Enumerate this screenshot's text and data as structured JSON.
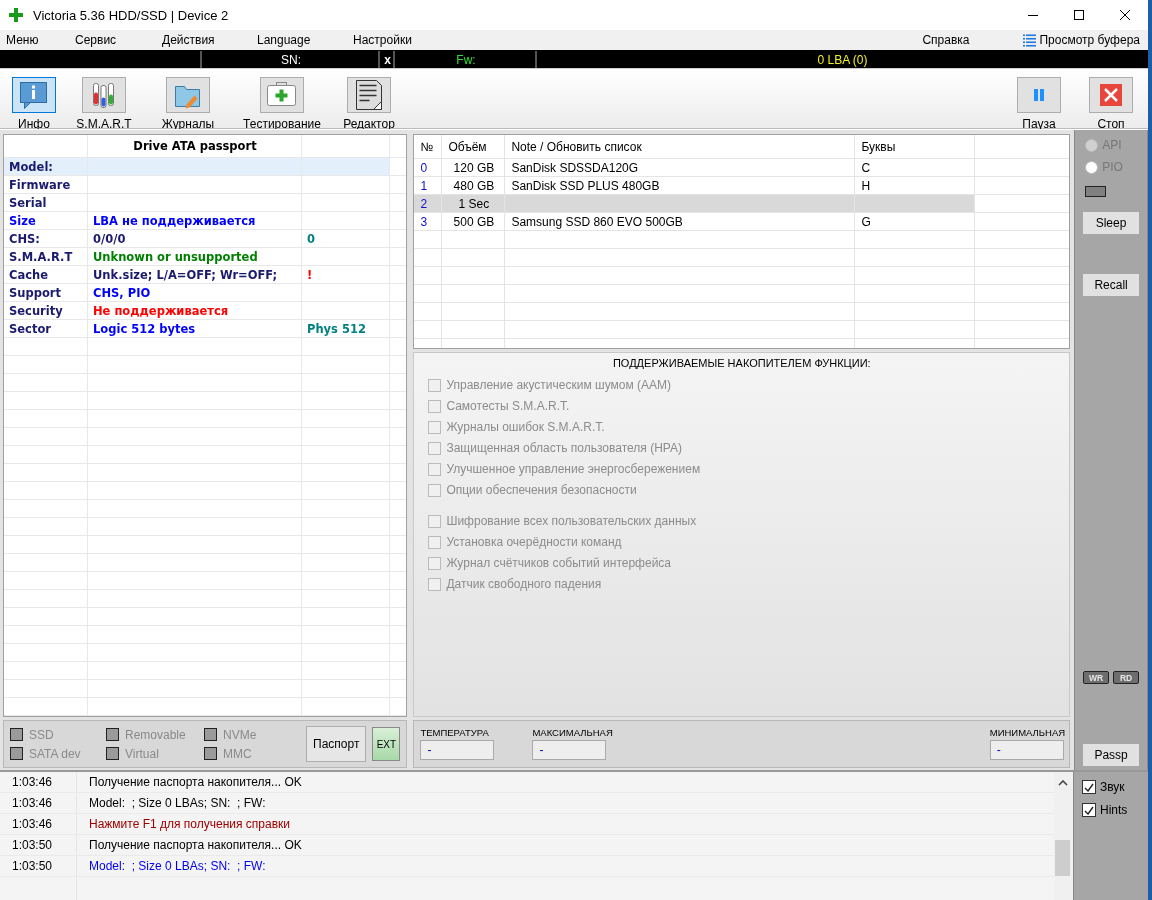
{
  "window": {
    "title": "Victoria 5.36 HDD/SSD | Device 2"
  },
  "menu": [
    "Меню",
    "Сервис",
    "Действия",
    "Language",
    "Настройки"
  ],
  "menu_right": {
    "help": "Справка",
    "buffer": "Просмотр буфера"
  },
  "info_strip": {
    "sn_label": "SN:",
    "separator": "x",
    "fw_label": "Fw:",
    "lba": "0 LBA (0)"
  },
  "toolbar": [
    {
      "label": "Инфо",
      "kind": "info",
      "selected": true
    },
    {
      "label": "S.M.A.R.T",
      "kind": "smart",
      "selected": false
    },
    {
      "label": "Журналы",
      "kind": "logs",
      "selected": false
    },
    {
      "label": "Тестирование",
      "kind": "test",
      "selected": false
    },
    {
      "label": "Редактор",
      "kind": "editor",
      "selected": false
    }
  ],
  "toolbar_right": [
    {
      "label": "Пауза",
      "kind": "pause"
    },
    {
      "label": "Стоп",
      "kind": "stop"
    }
  ],
  "passport": {
    "title": "Drive ATA passport",
    "rows": [
      {
        "label": {
          "text": "Model:",
          "color": "#1a1a6e"
        },
        "selected": true
      },
      {
        "label": {
          "text": "Firmware",
          "color": "#1a1a6e"
        },
        "selected": false
      },
      {
        "label": {
          "text": "Serial",
          "color": "#1a1a6e"
        },
        "selected": false
      },
      {
        "label": {
          "text": "Size",
          "color": "#0000ff"
        },
        "value": {
          "text": "LBA не поддерживается",
          "color": "#0000ff"
        },
        "selected": false
      },
      {
        "label": {
          "text": "CHS:",
          "color": "#1a1a6e"
        },
        "value": {
          "text": "0/0/0",
          "color": "#1a1a6e"
        },
        "extra": {
          "text": "0",
          "color": "#008080"
        },
        "selected": false
      },
      {
        "label": {
          "text": "S.M.A.R.T",
          "color": "#1a1a6e"
        },
        "value": {
          "text": "Unknown or unsupported",
          "color": "#008000"
        },
        "selected": false
      },
      {
        "label": {
          "text": "Cache",
          "color": "#1a1a6e"
        },
        "value": {
          "text": "Unk.size; L/A=OFF; Wr=OFF;",
          "color": "#1a1a6e"
        },
        "extra": {
          "text": "!",
          "color": "#ff0000"
        },
        "selected": false
      },
      {
        "label": {
          "text": "Support",
          "color": "#1a1a6e"
        },
        "value": {
          "text": "CHS, PIO",
          "color": "#0000ff"
        },
        "selected": false
      },
      {
        "label": {
          "text": "Security",
          "color": "#1a1a6e"
        },
        "value": {
          "text": "Не поддерживается",
          "color": "#ff0000"
        },
        "selected": false
      },
      {
        "label": {
          "text": "Sector",
          "color": "#1a1a6e"
        },
        "value": {
          "text": "Logic 512 bytes",
          "color": "#0000ff"
        },
        "extra": {
          "text": "Phys 512",
          "color": "#008080"
        },
        "selected": false
      }
    ]
  },
  "drives": {
    "columns": [
      "№",
      "Объём",
      "Note / Обновить список",
      "Буквы"
    ],
    "rows": [
      {
        "cells": [
          "0",
          "120 GB",
          "SanDisk SDSSDA120G",
          "C"
        ],
        "selected": false
      },
      {
        "cells": [
          "1",
          "480 GB",
          "SanDisk SSD PLUS 480GB",
          "H"
        ],
        "selected": false
      },
      {
        "cells": [
          "2",
          "1 Sec"
        ],
        "selected": true
      },
      {
        "cells": [
          "3",
          "500 GB",
          "Samsung SSD 860 EVO 500GB",
          "G"
        ],
        "selected": false
      }
    ]
  },
  "features": {
    "title": "ПОДДЕРЖИВАЕМЫЕ НАКОПИТЕЛЕМ ФУНКЦИИ:",
    "groups": [
      [
        {
          "label": "Управление акустическим шумом (AAM)",
          "checked": false,
          "disabled": true
        },
        {
          "label": "Самотесты S.M.A.R.T.",
          "checked": false,
          "disabled": true
        },
        {
          "label": "Журналы ошибок S.M.A.R.T.",
          "checked": false,
          "disabled": true
        },
        {
          "label": "Защищенная область пользователя (HPA)",
          "checked": false,
          "disabled": true
        },
        {
          "label": "Улучшенное управление энергосбережением",
          "checked": false,
          "disabled": true
        },
        {
          "label": "Опции обеспечения безопасности",
          "checked": false,
          "disabled": true
        }
      ],
      [
        {
          "label": "Шифрование всех пользовательских данных",
          "checked": false,
          "disabled": true
        },
        {
          "label": "Установка очерёдности команд",
          "checked": false,
          "disabled": true
        },
        {
          "label": "Журнал счётчиков событий интерфейса",
          "checked": false,
          "disabled": true
        },
        {
          "label": "Датчик свободного падения",
          "checked": false,
          "disabled": true
        }
      ]
    ]
  },
  "flags": [
    {
      "label": "SSD",
      "on": false
    },
    {
      "label": "Removable",
      "on": false
    },
    {
      "label": "NVMe",
      "on": false
    },
    {
      "label": "SATA dev",
      "on": false
    },
    {
      "label": "Virtual",
      "on": false
    },
    {
      "label": "MMC",
      "on": false
    }
  ],
  "passport_button": "Паспорт",
  "ext_button": {
    "label": "EXT",
    "on": true
  },
  "temperatures": [
    {
      "label": "ТЕМПЕРАТУРА",
      "value": "-"
    },
    {
      "label": "МАКСИМАЛЬНАЯ",
      "value": "-"
    },
    {
      "label": "МИНИМАЛЬНАЯ",
      "value": "-"
    }
  ],
  "side": {
    "modes": [
      {
        "label": "API",
        "selected": false,
        "disabled": true
      },
      {
        "label": "PIO",
        "selected": false,
        "disabled": false
      }
    ],
    "buttons": [
      "Sleep",
      "Recall"
    ],
    "indicators": [
      {
        "label": "WR",
        "on": false
      },
      {
        "label": "RD",
        "on": false
      }
    ],
    "passp": "Passp",
    "options": [
      {
        "label": "Звук",
        "checked": true
      },
      {
        "label": "Hints",
        "checked": true
      }
    ]
  },
  "log": [
    {
      "time": "1:03:46",
      "text": "Получение паспорта накопителя... OK",
      "kind": "normal"
    },
    {
      "time": "1:03:46",
      "text": "Model:  ; Size 0 LBAs; SN:  ; FW:",
      "kind": "normal"
    },
    {
      "time": "1:03:46",
      "text": "Нажмите F1 для получения справки",
      "kind": "error"
    },
    {
      "time": "1:03:50",
      "text": "Получение паспорта накопителя... OK",
      "kind": "normal"
    },
    {
      "time": "1:03:50",
      "text": "Model:  ; Size 0 LBAs; SN:  ; FW:",
      "kind": "info"
    }
  ]
}
